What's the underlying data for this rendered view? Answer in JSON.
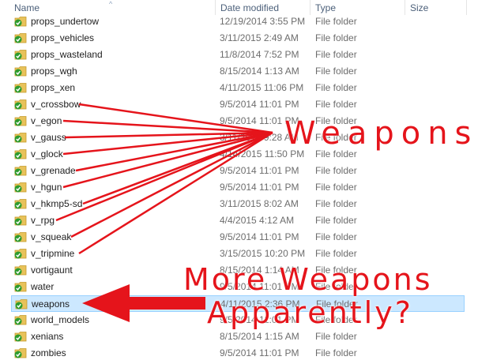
{
  "columns": {
    "name": "Name",
    "date": "Date modified",
    "type": "Type",
    "size": "Size"
  },
  "files": [
    {
      "name": "props_undertow",
      "date": "12/19/2014 3:55 PM",
      "type": "File folder"
    },
    {
      "name": "props_vehicles",
      "date": "3/11/2015 2:49 AM",
      "type": "File folder"
    },
    {
      "name": "props_wasteland",
      "date": "11/8/2014 7:52 PM",
      "type": "File folder"
    },
    {
      "name": "props_wgh",
      "date": "8/15/2014 1:13 AM",
      "type": "File folder"
    },
    {
      "name": "props_xen",
      "date": "4/11/2015 11:06 PM",
      "type": "File folder"
    },
    {
      "name": "v_crossbow",
      "date": "9/5/2014 11:01 PM",
      "type": "File folder"
    },
    {
      "name": "v_egon",
      "date": "9/5/2014 11:01 PM",
      "type": "File folder"
    },
    {
      "name": "v_gauss",
      "date": "3/11/2015 9:28 AM",
      "type": "File folder"
    },
    {
      "name": "v_glock",
      "date": "4/14/2015 11:50 PM",
      "type": "File folder"
    },
    {
      "name": "v_grenade",
      "date": "9/5/2014 11:01 PM",
      "type": "File folder"
    },
    {
      "name": "v_hgun",
      "date": "9/5/2014 11:01 PM",
      "type": "File folder"
    },
    {
      "name": "v_hkmp5-sd",
      "date": "3/11/2015 8:02 AM",
      "type": "File folder"
    },
    {
      "name": "v_rpg",
      "date": "4/4/2015 4:12 AM",
      "type": "File folder"
    },
    {
      "name": "v_squeak",
      "date": "9/5/2014 11:01 PM",
      "type": "File folder"
    },
    {
      "name": "v_tripmine",
      "date": "3/15/2015 10:20 PM",
      "type": "File folder"
    },
    {
      "name": "vortigaunt",
      "date": "8/15/2014 1:14 AM",
      "type": "File folder"
    },
    {
      "name": "water",
      "date": "9/5/2014 11:01 PM",
      "type": "File folder"
    },
    {
      "name": "weapons",
      "date": "4/11/2015 2:36 PM",
      "type": "File folder"
    },
    {
      "name": "world_models",
      "date": "9/5/2014 11:01 PM",
      "type": "File folder"
    },
    {
      "name": "xenians",
      "date": "8/15/2014 1:15 AM",
      "type": "File folder"
    },
    {
      "name": "zombies",
      "date": "9/5/2014 11:01 PM",
      "type": "File folder"
    }
  ],
  "selected_row": "weapons",
  "annotations": {
    "weapons_label": "Weapons",
    "more_line1": "More Weapons",
    "more_line2": "Apparently?"
  },
  "icons": {
    "folder": "folder-sync-icon",
    "sort": "sort-up-icon"
  },
  "colors": {
    "annotation": "#e5141b",
    "selection": "#cce8ff",
    "header_text": "#4c607a",
    "folder": "#e8c25a",
    "sync_badge": "#2e9b2e"
  }
}
